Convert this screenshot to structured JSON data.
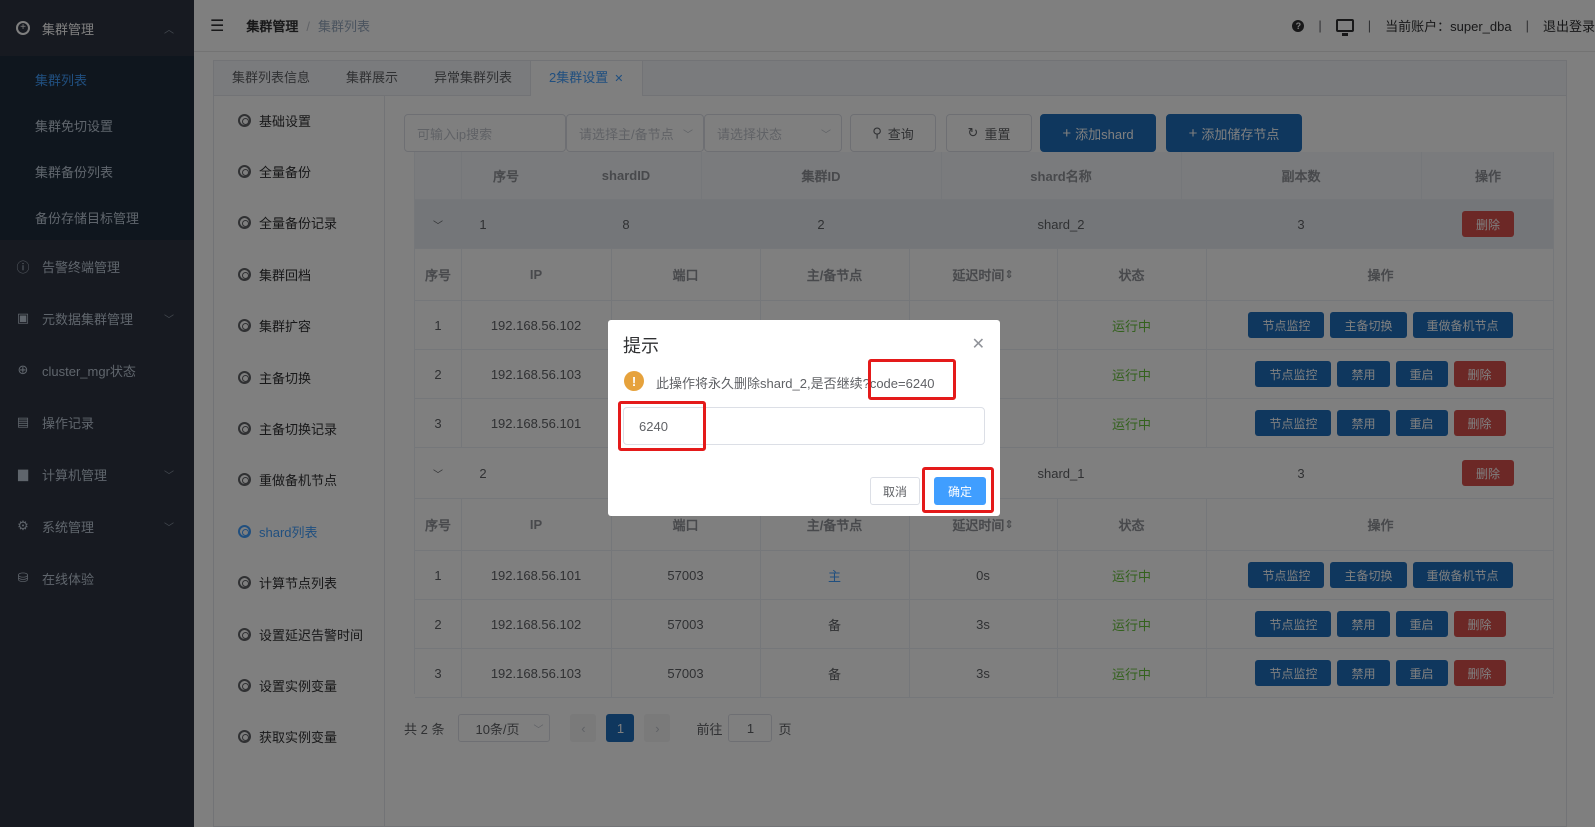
{
  "sidebar": {
    "top": {
      "label": "集群管理",
      "icon": "plus-circle-icon"
    },
    "sub_items": [
      {
        "label": "集群列表",
        "active": true
      },
      {
        "label": "集群免切设置"
      },
      {
        "label": "集群备份列表"
      },
      {
        "label": "备份存储目标管理"
      }
    ],
    "menu": [
      {
        "label": "告警终端管理",
        "icon": "alert-icon",
        "arrow": false
      },
      {
        "label": "元数据集群管理",
        "icon": "database-icon",
        "arrow": true
      },
      {
        "label": "cluster_mgr状态",
        "icon": "status-icon",
        "arrow": false
      },
      {
        "label": "操作记录",
        "icon": "record-icon",
        "arrow": false
      },
      {
        "label": "计算机管理",
        "icon": "monitor-icon",
        "arrow": true
      },
      {
        "label": "系统管理",
        "icon": "gear-icon",
        "arrow": true
      },
      {
        "label": "在线体验",
        "icon": "cylinder-icon",
        "arrow": false
      }
    ]
  },
  "header": {
    "breadcrumb": [
      "集群管理",
      "集群列表"
    ],
    "account_label": "当前账户：super_dba",
    "logout": "退出登录"
  },
  "tabs": [
    {
      "label": "集群列表信息"
    },
    {
      "label": "集群展示"
    },
    {
      "label": "异常集群列表"
    },
    {
      "label": "2集群设置",
      "active": true,
      "closable": true
    }
  ],
  "leftnav": [
    "基础设置",
    "全量备份",
    "全量备份记录",
    "集群回档",
    "集群扩容",
    "主备切换",
    "主备切换记录",
    "重做备机节点",
    "shard列表",
    "计算节点列表",
    "设置延迟告警时间",
    "设置实例变量",
    "获取实例变量"
  ],
  "leftnav_active": 8,
  "toolbar": {
    "ip_placeholder": "可输入ip搜索",
    "node_placeholder": "请选择主/备节点",
    "status_placeholder": "请选择状态",
    "search": "查询",
    "reset": "重置",
    "add_shard": "添加shard",
    "add_storage": "添加储存节点"
  },
  "shard_table": {
    "headers": [
      "序号",
      "shardID",
      "集群ID",
      "shard名称",
      "副本数",
      "操作"
    ],
    "sub_headers": [
      "序号",
      "IP",
      "端口",
      "主/备节点",
      "延迟时间",
      "状态",
      "操作"
    ],
    "shards": [
      {
        "index": "1",
        "shard_id": "8",
        "cluster_id": "2",
        "name": "shard_2",
        "replicas": "3",
        "action": "删除",
        "nodes": [
          {
            "index": "1",
            "ip": "192.168.56.102",
            "port": "",
            "role": "",
            "delay": "",
            "status": "运行中",
            "actions": [
              "节点监控",
              "主备切换",
              "重做备机节点"
            ]
          },
          {
            "index": "2",
            "ip": "192.168.56.103",
            "port": "",
            "role": "",
            "delay": "",
            "status": "运行中",
            "actions": [
              "节点监控",
              "禁用",
              "重启",
              "删除"
            ]
          },
          {
            "index": "3",
            "ip": "192.168.56.101",
            "port": "",
            "role": "",
            "delay": "",
            "status": "运行中",
            "actions": [
              "节点监控",
              "禁用",
              "重启",
              "删除"
            ]
          }
        ]
      },
      {
        "index": "2",
        "shard_id": "",
        "cluster_id": "",
        "name": "shard_1",
        "replicas": "3",
        "action": "删除",
        "nodes": [
          {
            "index": "1",
            "ip": "192.168.56.101",
            "port": "57003",
            "role": "主",
            "delay": "0s",
            "status": "运行中",
            "actions": [
              "节点监控",
              "主备切换",
              "重做备机节点"
            ]
          },
          {
            "index": "2",
            "ip": "192.168.56.102",
            "port": "57003",
            "role": "备",
            "delay": "3s",
            "status": "运行中",
            "actions": [
              "节点监控",
              "禁用",
              "重启",
              "删除"
            ]
          },
          {
            "index": "3",
            "ip": "192.168.56.103",
            "port": "57003",
            "role": "备",
            "delay": "3s",
            "status": "运行中",
            "actions": [
              "节点监控",
              "禁用",
              "重启",
              "删除"
            ]
          }
        ]
      }
    ]
  },
  "pagination": {
    "total": "共 2 条",
    "page_size": "10条/页",
    "current_page": "1",
    "goto_label": "前往",
    "goto_value": "1",
    "page_unit": "页"
  },
  "modal": {
    "title": "提示",
    "message": "此操作将永久删除shard_2,是否继续?code=6240",
    "input_value": "6240",
    "cancel": "取消",
    "confirm": "确定"
  },
  "colors": {
    "primary": "#409eff",
    "button_blue": "#1f6fbd",
    "danger": "#d8504d",
    "success": "#67c23a",
    "sidebar": "#2f3442"
  }
}
